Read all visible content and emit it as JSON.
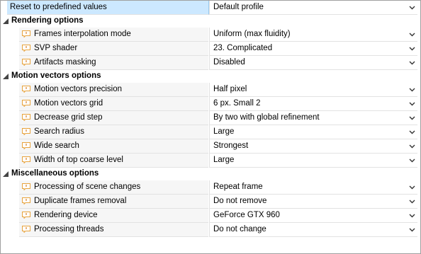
{
  "header_row": {
    "name": "Reset to predefined values",
    "value": "Default profile"
  },
  "icons": {
    "property": "comment-icon",
    "dropdown": "chevron-down-icon",
    "collapse": "collapse-triangle-icon"
  },
  "colors": {
    "selected_bg": "#cce8ff",
    "name_bg": "#f6f6f6",
    "icon_orange": "#e8a33c"
  },
  "sections": [
    {
      "title": "Rendering options",
      "rows": [
        {
          "name": "Frames interpolation mode",
          "value": "Uniform (max fluidity)"
        },
        {
          "name": "SVP shader",
          "value": "23. Complicated"
        },
        {
          "name": "Artifacts masking",
          "value": "Disabled"
        }
      ]
    },
    {
      "title": "Motion vectors options",
      "rows": [
        {
          "name": "Motion vectors precision",
          "value": "Half pixel"
        },
        {
          "name": "Motion vectors grid",
          "value": "6 px. Small 2"
        },
        {
          "name": "Decrease grid step",
          "value": "By two with global refinement"
        },
        {
          "name": "Search radius",
          "value": "Large"
        },
        {
          "name": "Wide search",
          "value": "Strongest"
        },
        {
          "name": "Width of top coarse level",
          "value": "Large"
        }
      ]
    },
    {
      "title": "Miscellaneous options",
      "rows": [
        {
          "name": "Processing of scene changes",
          "value": "Repeat frame"
        },
        {
          "name": "Duplicate frames removal",
          "value": "Do not remove"
        },
        {
          "name": "Rendering device",
          "value": "GeForce GTX 960"
        },
        {
          "name": "Processing threads",
          "value": "Do not change"
        }
      ]
    }
  ]
}
